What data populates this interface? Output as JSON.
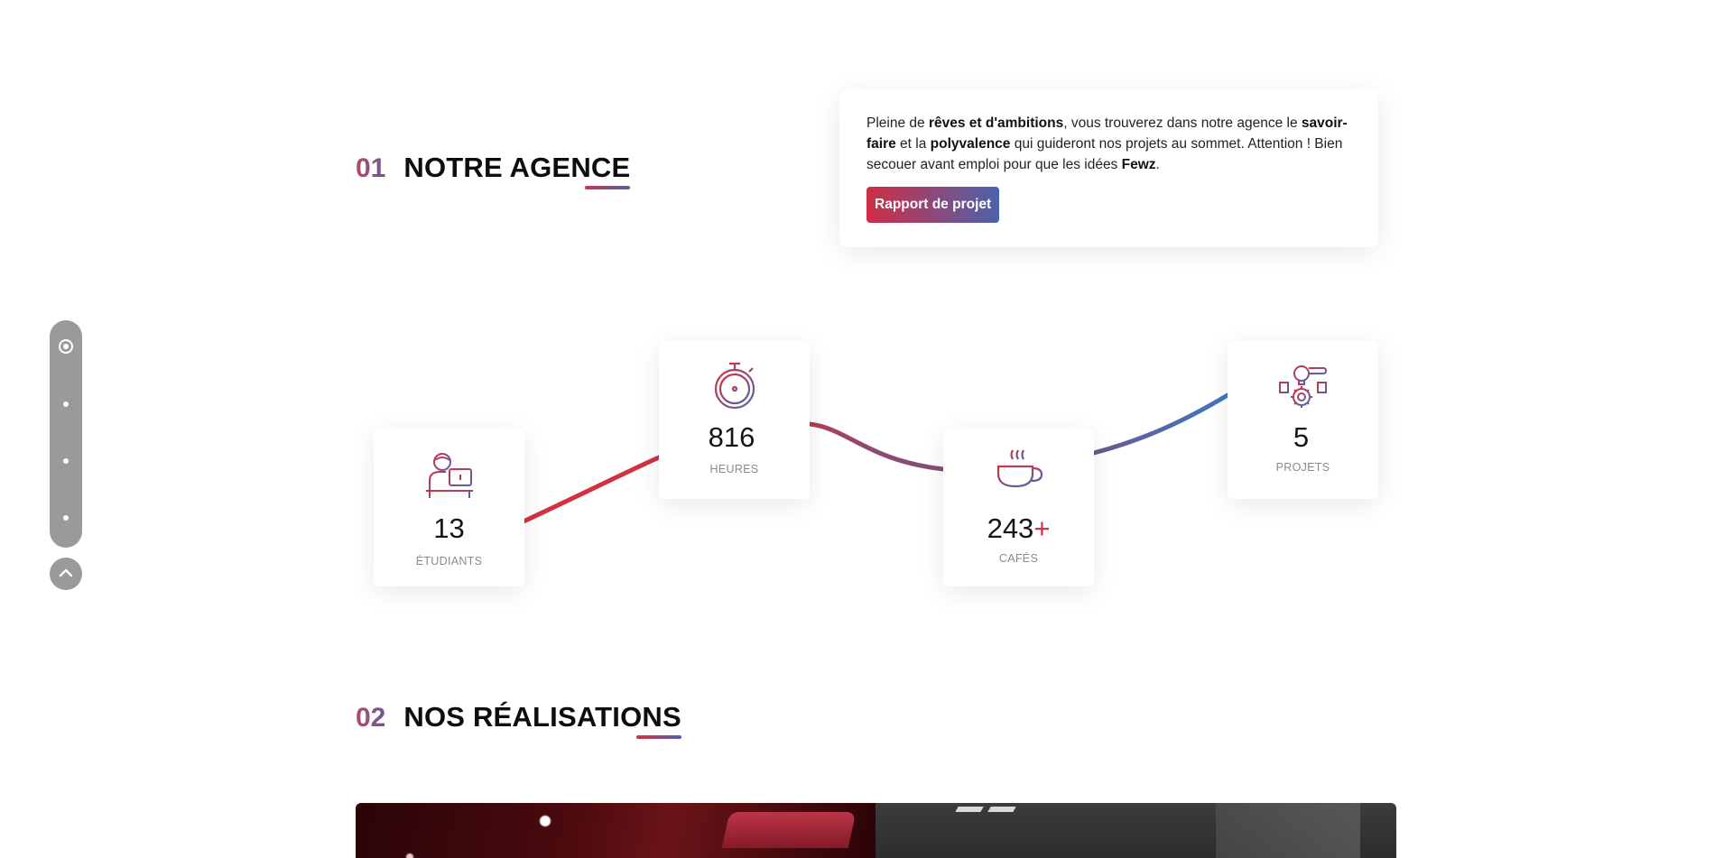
{
  "nav": {
    "dots": [
      "section-1",
      "section-2",
      "section-3",
      "section-4"
    ],
    "active_index": 0,
    "up_icon": "chevron-up-icon"
  },
  "section1": {
    "number": "01",
    "title": "NOTRE AGENCE",
    "intro": {
      "p1": "Pleine de ",
      "b1": "rêves et d'ambitions",
      "p2": ", vous trouverez dans notre agence le ",
      "b2": "savoir-faire",
      "p3": " et la ",
      "b3": "polyvalence",
      "p4": " qui guideront nos projets au sommet. Attention ! Bien secouer avant emploi pour que les idées ",
      "b4": "Fewz",
      "p5": "."
    },
    "button_label": "Rapport de projet"
  },
  "stats": [
    {
      "value": "13",
      "label": "ÉTUDIANTS",
      "icon": "student-computer-icon"
    },
    {
      "value": "816",
      "label": "HEURES",
      "icon": "stopwatch-icon"
    },
    {
      "value": "243",
      "suffix": "+",
      "label": "CAFÉS",
      "icon": "coffee-cup-icon"
    },
    {
      "value": "5",
      "label": "PROJETS",
      "icon": "idea-gear-icon"
    }
  ],
  "section2": {
    "number": "02",
    "title": "NOS RÉALISATIONS"
  },
  "colors": {
    "red": "#d6303e",
    "blue": "#4e64ad",
    "purple": "#8c4a72",
    "nav_gray": "#9a9a9a"
  }
}
